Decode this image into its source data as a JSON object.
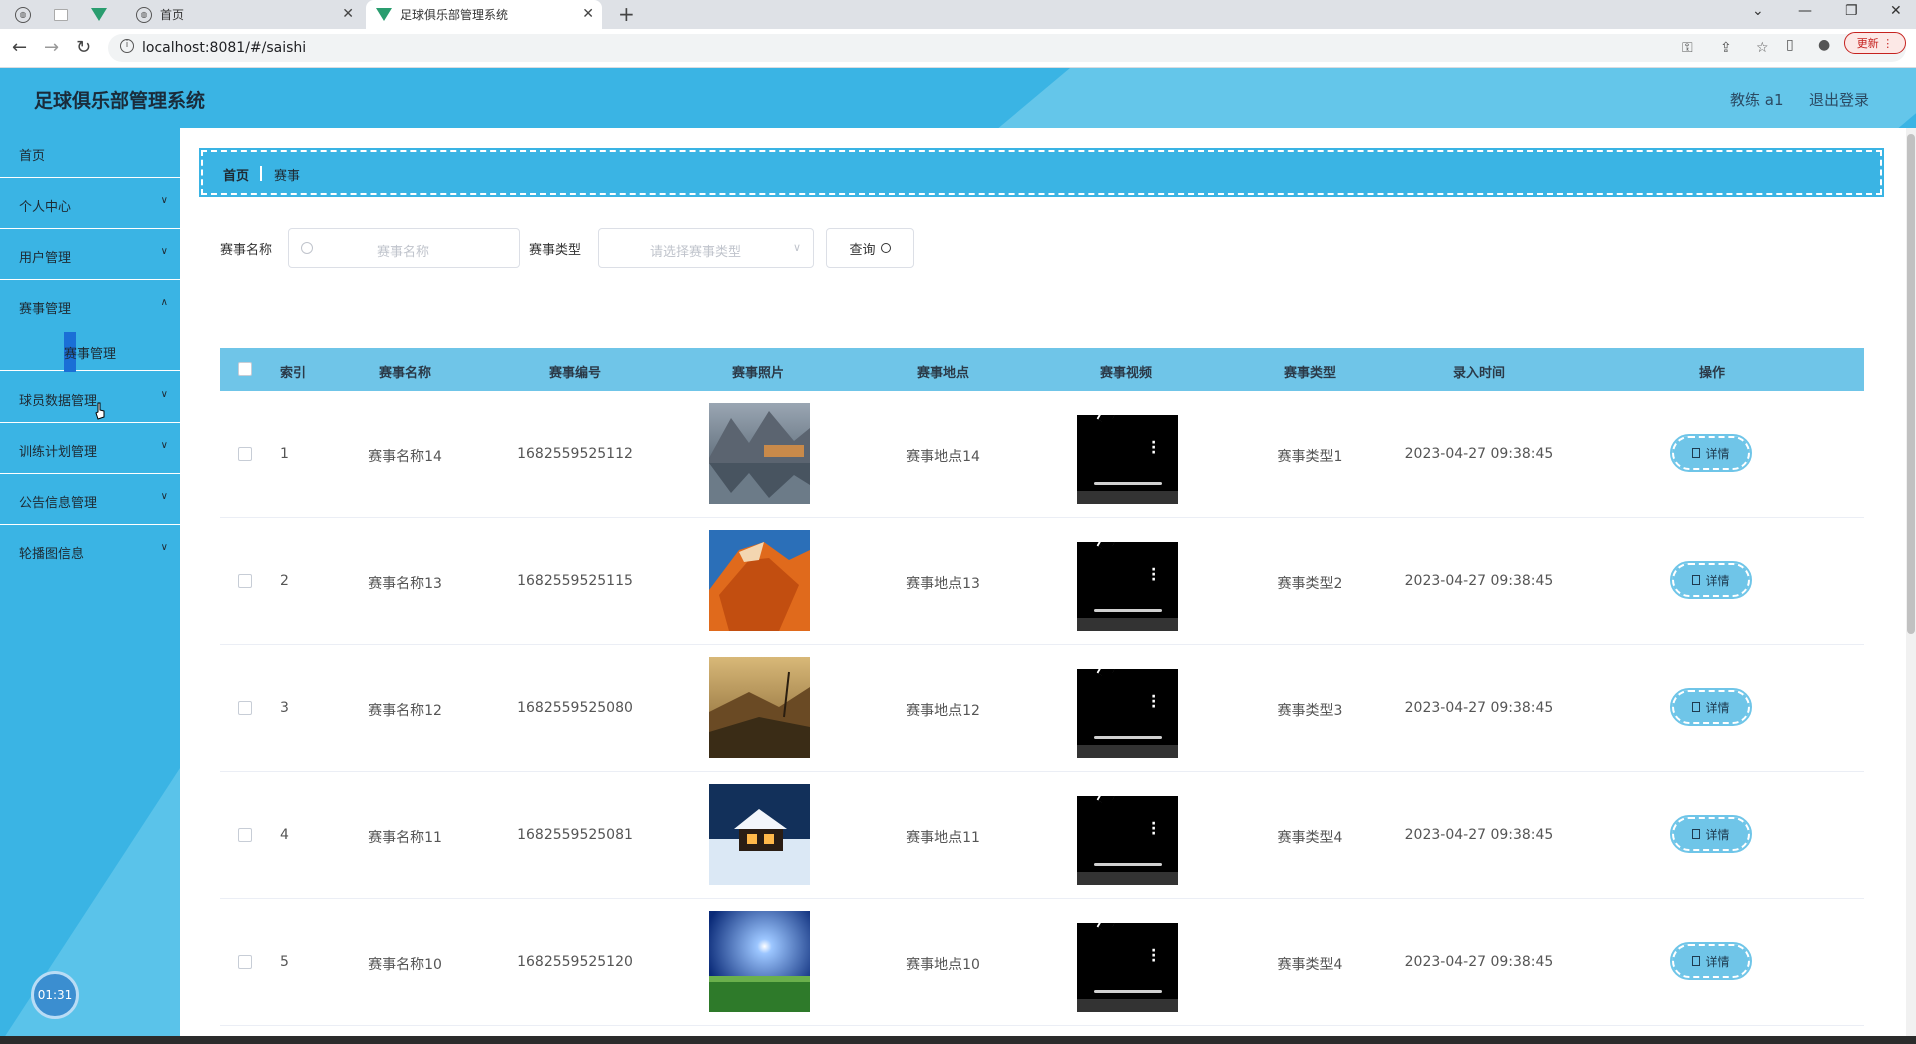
{
  "browser": {
    "tabs": [
      {
        "title": "首页",
        "active": false
      },
      {
        "title": "足球俱乐部管理系统",
        "active": true
      }
    ],
    "url": "localhost:8081/#/saishi",
    "update_label": "更新"
  },
  "header": {
    "title": "足球俱乐部管理系统",
    "user": "教练 a1",
    "logout": "退出登录"
  },
  "sidebar": {
    "items": [
      {
        "label": "首页",
        "has_children": false
      },
      {
        "label": "个人中心",
        "has_children": true
      },
      {
        "label": "用户管理",
        "has_children": true
      },
      {
        "label": "赛事管理",
        "has_children": true
      },
      {
        "label": "球员数据管理",
        "has_children": true
      },
      {
        "label": "训练计划管理",
        "has_children": true
      },
      {
        "label": "公告信息管理",
        "has_children": true
      },
      {
        "label": "轮播图信息",
        "has_children": true
      }
    ],
    "active_sub": "赛事管理",
    "clock": "01:31"
  },
  "breadcrumb": {
    "home": "首页",
    "current": "赛事"
  },
  "filters": {
    "name_label": "赛事名称",
    "name_placeholder": "赛事名称",
    "type_label": "赛事类型",
    "type_placeholder": "请选择赛事类型",
    "query_label": "查询"
  },
  "table": {
    "columns": [
      "索引",
      "赛事名称",
      "赛事编号",
      "赛事照片",
      "赛事地点",
      "赛事视频",
      "赛事类型",
      "录入时间",
      "操作"
    ],
    "rows": [
      {
        "index": "1",
        "name": "赛事名称14",
        "code": "1682559525112",
        "photo": "mountain-lake",
        "location": "赛事地点14",
        "type": "赛事类型1",
        "time": "2023-04-27 09:38:45"
      },
      {
        "index": "2",
        "name": "赛事名称13",
        "code": "1682559525115",
        "photo": "orange-rock",
        "location": "赛事地点13",
        "type": "赛事类型2",
        "time": "2023-04-27 09:38:45"
      },
      {
        "index": "3",
        "name": "赛事名称12",
        "code": "1682559525080",
        "photo": "sunset-valley",
        "location": "赛事地点12",
        "type": "赛事类型3",
        "time": "2023-04-27 09:38:45"
      },
      {
        "index": "4",
        "name": "赛事名称11",
        "code": "1682559525081",
        "photo": "snow-cabin",
        "location": "赛事地点11",
        "type": "赛事类型4",
        "time": "2023-04-27 09:38:45"
      },
      {
        "index": "5",
        "name": "赛事名称10",
        "code": "1682559525120",
        "photo": "moon-field",
        "location": "赛事地点10",
        "type": "赛事类型4",
        "time": "2023-04-27 09:38:45"
      }
    ],
    "detail_label": "详情"
  },
  "colors": {
    "primary": "#3ab4e4",
    "table_header": "#6fc5e8"
  }
}
